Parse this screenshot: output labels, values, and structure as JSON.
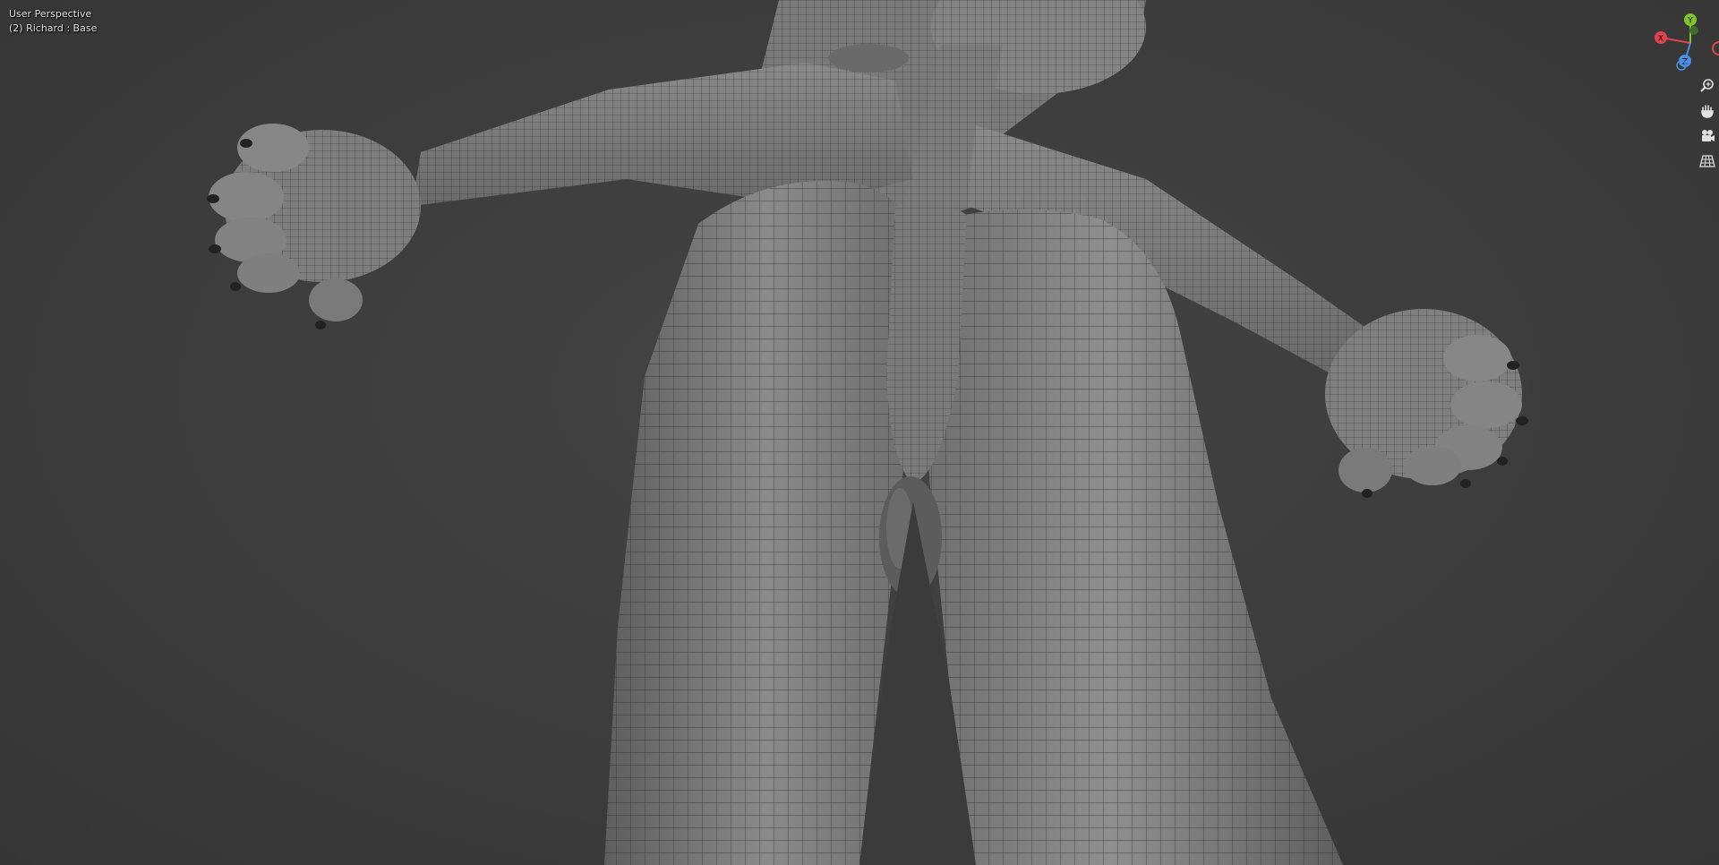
{
  "viewport": {
    "view_name": "User Perspective",
    "object_info": "(2) Richard : Base"
  },
  "gizmo": {
    "axes": [
      {
        "name": "X",
        "color": "#e2434f"
      },
      {
        "name": "Y",
        "color": "#7fc42a"
      },
      {
        "name": "Z",
        "color": "#4b8ee6"
      }
    ]
  },
  "navigation": [
    {
      "name": "zoom",
      "icon": "zoom-icon"
    },
    {
      "name": "pan",
      "icon": "hand-icon"
    },
    {
      "name": "camera",
      "icon": "camera-icon"
    },
    {
      "name": "orthographic",
      "icon": "grid-icon"
    }
  ],
  "colors": {
    "background": "#3d3d3d",
    "mesh": "#808080",
    "wireframe": "#2a2a2a"
  }
}
